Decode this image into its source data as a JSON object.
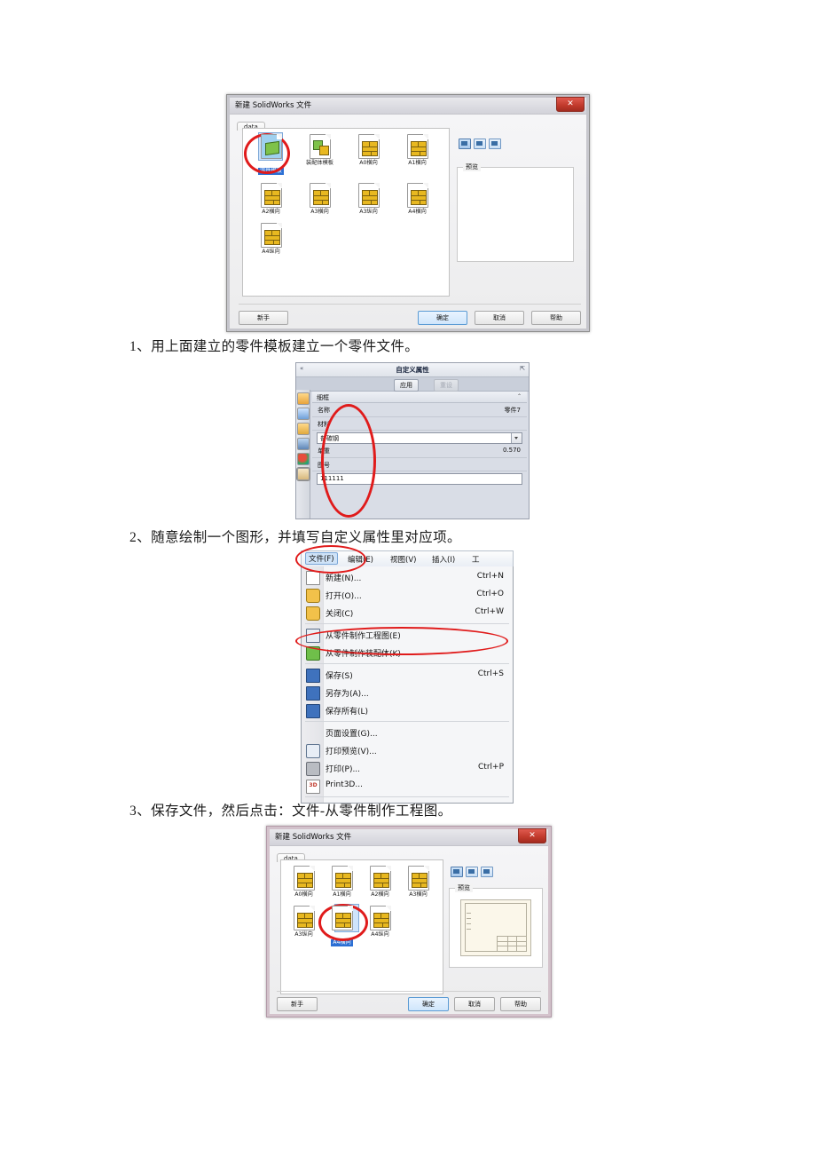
{
  "document": {
    "language": "zh-CN",
    "steps": [
      {
        "number": "1、",
        "text": "用上面建立的零件模板建立一个零件文件。"
      },
      {
        "number": "2、",
        "text": "随意绘制一个图形，并填写自定义属性里对应项。"
      },
      {
        "number": "3、",
        "text": "保存文件，然后点击：文件-从零件制作工程图。"
      }
    ]
  },
  "new_file_dialog_1": {
    "title": "新建 SolidWorks 文件",
    "close_label": "✕",
    "tab": "data",
    "templates": [
      {
        "label": "零件模板",
        "selected": true,
        "kind": "part"
      },
      {
        "label": "装配体模板",
        "selected": false,
        "kind": "assembly"
      },
      {
        "label": "A0横向",
        "selected": false,
        "kind": "drawing"
      },
      {
        "label": "A1横向",
        "selected": false,
        "kind": "drawing"
      },
      {
        "label": "A2横向",
        "selected": false,
        "kind": "drawing"
      },
      {
        "label": "A3横向",
        "selected": false,
        "kind": "drawing"
      },
      {
        "label": "A3纵向",
        "selected": false,
        "kind": "drawing"
      },
      {
        "label": "A4横向",
        "selected": false,
        "kind": "drawing"
      },
      {
        "label": "A4纵向",
        "selected": false,
        "kind": "drawing"
      }
    ],
    "preview_label": "预览",
    "buttons": {
      "novice": "新手",
      "ok": "确定",
      "cancel": "取消",
      "help": "帮助"
    }
  },
  "custom_properties_panel": {
    "title": "自定义属性",
    "collapse_icon": "«",
    "pin_icon": "⇱",
    "apply_label": "应用",
    "reset_label": "重设",
    "group_header": "细框",
    "group_collapse": "⌃",
    "fields": [
      {
        "key": "名称",
        "value": "零件7",
        "type": "readonly"
      },
      {
        "key": "材料",
        "value": "普碳钢",
        "type": "dropdown"
      },
      {
        "key": "单重",
        "value": "0.570",
        "type": "readonly"
      },
      {
        "key": "图号",
        "value": "111111",
        "type": "text"
      }
    ],
    "sidebar_icons": [
      "home-icon",
      "chart-icon",
      "folder-icon",
      "appearances-icon",
      "display-manager-icon",
      "custom-properties-icon"
    ]
  },
  "file_menu": {
    "menubar": [
      {
        "label": "文件(F)",
        "active": true
      },
      {
        "label": "编辑(E)",
        "active": false
      },
      {
        "label": "视图(V)",
        "active": false
      },
      {
        "label": "插入(I)",
        "active": false
      },
      {
        "label": "工",
        "active": false
      }
    ],
    "items": [
      {
        "label": "新建(N)...",
        "accel": "Ctrl+N",
        "icon": "new-doc-icon",
        "sep_after": false
      },
      {
        "label": "打开(O)...",
        "accel": "Ctrl+O",
        "icon": "open-folder-icon",
        "sep_after": false
      },
      {
        "label": "关闭(C)",
        "accel": "Ctrl+W",
        "icon": "close-folder-icon",
        "sep_after": true
      },
      {
        "label": "从零件制作工程图(E)",
        "accel": "",
        "icon": "make-drawing-icon",
        "sep_after": false
      },
      {
        "label": "从零件制作装配体(K)",
        "accel": "",
        "icon": "make-assembly-icon",
        "sep_after": true
      },
      {
        "label": "保存(S)",
        "accel": "Ctrl+S",
        "icon": "save-icon",
        "sep_after": false
      },
      {
        "label": "另存为(A)...",
        "accel": "",
        "icon": "save-as-icon",
        "sep_after": false
      },
      {
        "label": "保存所有(L)",
        "accel": "",
        "icon": "save-all-icon",
        "sep_after": true
      },
      {
        "label": "页面设置(G)...",
        "accel": "",
        "icon": "page-setup-icon",
        "sep_after": false
      },
      {
        "label": "打印预览(V)...",
        "accel": "",
        "icon": "print-preview-icon",
        "sep_after": false
      },
      {
        "label": "打印(P)...",
        "accel": "Ctrl+P",
        "icon": "print-icon",
        "sep_after": false
      },
      {
        "label": "Print3D...",
        "accel": "",
        "icon": "print3d-icon",
        "sep_after": true
      }
    ]
  },
  "new_file_dialog_2": {
    "title": "新建 SolidWorks 文件",
    "close_label": "✕",
    "tab": "data",
    "templates": [
      {
        "label": "A0横向",
        "selected": false
      },
      {
        "label": "A1横向",
        "selected": false
      },
      {
        "label": "A2横向",
        "selected": false
      },
      {
        "label": "A3横向",
        "selected": false
      },
      {
        "label": "A3纵向",
        "selected": false
      },
      {
        "label": "A4横向",
        "selected": true
      },
      {
        "label": "A4纵向",
        "selected": false
      }
    ],
    "preview_label": "预览",
    "buttons": {
      "novice": "新手",
      "ok": "确定",
      "cancel": "取消",
      "help": "帮助"
    }
  },
  "annotations": {
    "highlight_color": "#e01b1b",
    "marks": [
      "part-template-icon-circled",
      "custom-properties-fields-circled",
      "file-menu-circled",
      "make-drawing-item-circled",
      "a4-landscape-template-circled"
    ]
  }
}
